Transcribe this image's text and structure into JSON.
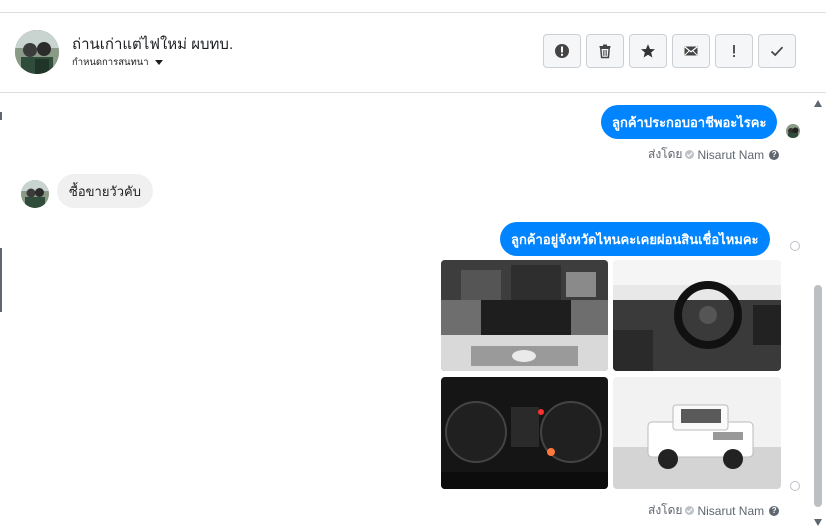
{
  "conversation": {
    "title": "ถ่านเก่าแต่ไฟใหม่ ผบทบ.",
    "subtitle": "กำหนดการสนทนา"
  },
  "actions": [
    {
      "name": "report-icon",
      "label": "!"
    },
    {
      "name": "trash-icon",
      "label": ""
    },
    {
      "name": "star-icon",
      "label": ""
    },
    {
      "name": "mail-icon",
      "label": ""
    },
    {
      "name": "exclamation-icon",
      "label": "!"
    },
    {
      "name": "checkmark-icon",
      "label": "✓"
    }
  ],
  "messages": {
    "m1": "ลูกค้าประกอบอาชีพอะไรคะ",
    "m2": "ซื้อขายวัวคับ",
    "m3": "ลูกค้าอยู่จังหวัดไหนคะเคยผ่อนสินเชื่อไหมคะ"
  },
  "sent_by": {
    "prefix": "ส่งโดย",
    "name": "Nisarut Nam"
  },
  "colors": {
    "outgoing_bubble": "#0084ff",
    "incoming_bubble": "#f1f0f0"
  }
}
